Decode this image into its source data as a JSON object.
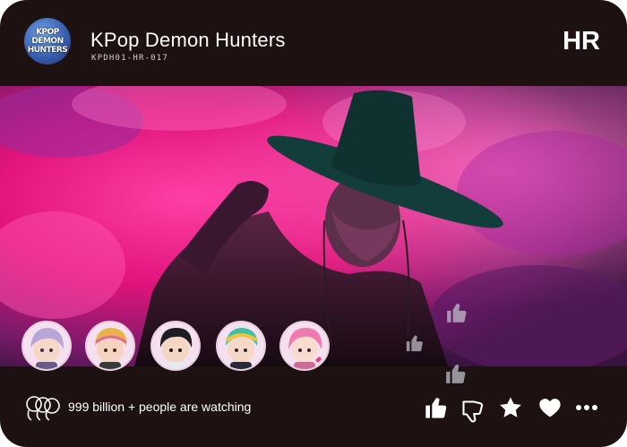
{
  "header": {
    "logo_lines": [
      "KPOP",
      "DEMON",
      "HUNTERS"
    ],
    "title": "KPop Demon Hunters",
    "code": "KPDH01-HR-017",
    "badge": "HR"
  },
  "scene": {
    "description_icon": "artwork-image"
  },
  "avatars": [
    {
      "name": "avatar-1",
      "hair": "#b9a6d8",
      "icon": "chibi-avatar"
    },
    {
      "name": "avatar-2",
      "hair": "#e8b44a",
      "icon": "chibi-avatar"
    },
    {
      "name": "avatar-3",
      "hair": "#1e1e24",
      "icon": "chibi-avatar"
    },
    {
      "name": "avatar-4",
      "hair": "#3cc0a6",
      "icon": "chibi-avatar"
    },
    {
      "name": "avatar-5",
      "hair": "#f07ab0",
      "icon": "chibi-avatar"
    }
  ],
  "footer": {
    "watching_text": "999 billion + people are watching",
    "watching_icon": "people-icon",
    "actions": [
      "thumbs-up-icon",
      "thumbs-down-icon",
      "star-icon",
      "heart-icon",
      "more-icon"
    ]
  },
  "colors": {
    "background": "#1d1112",
    "accent_pink": "#e8207a",
    "text": "#ffffff"
  }
}
